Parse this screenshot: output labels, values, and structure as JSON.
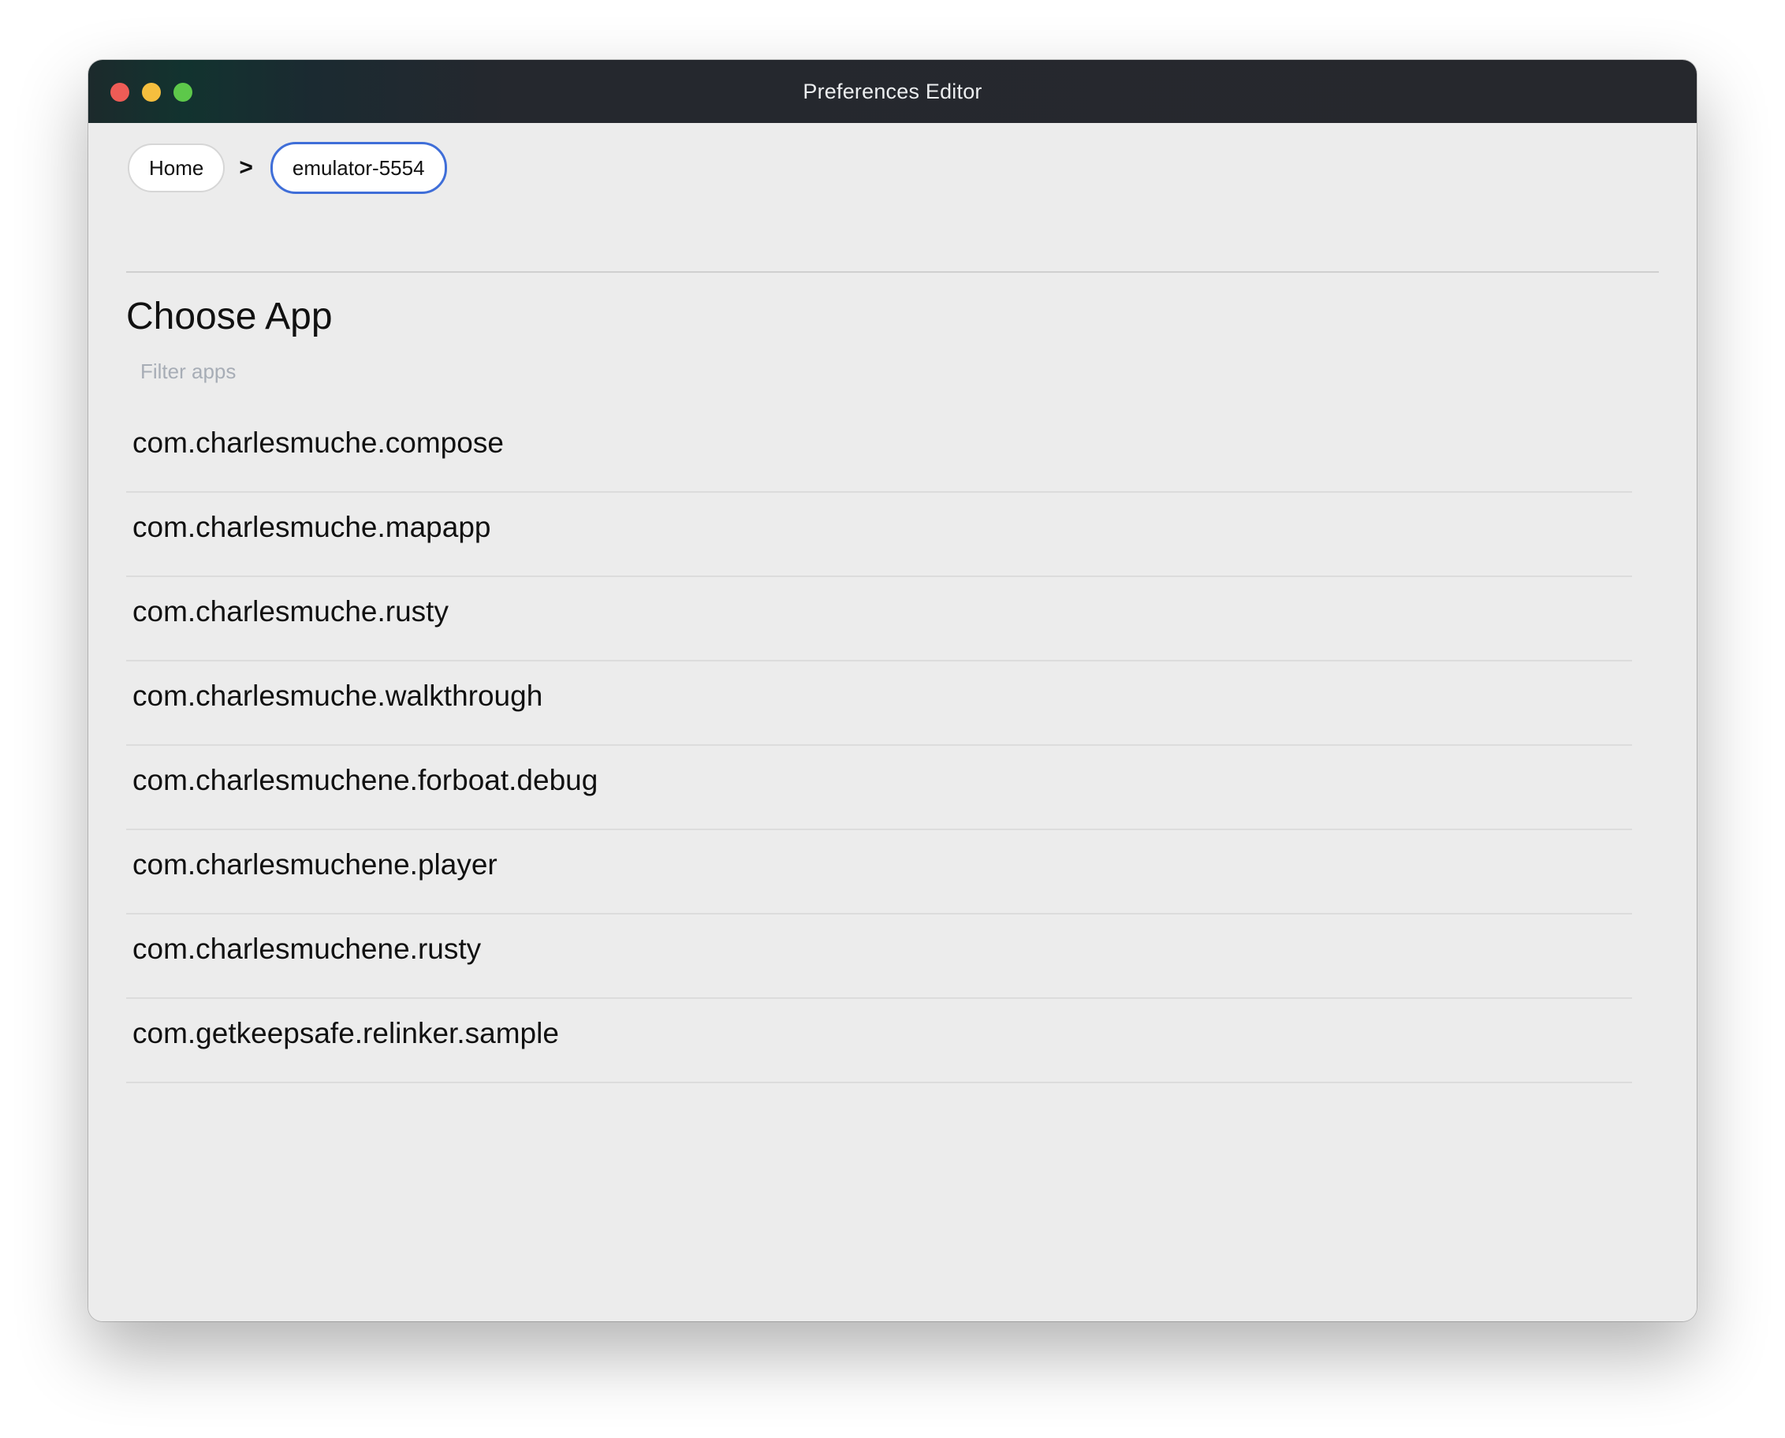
{
  "window": {
    "title": "Preferences Editor"
  },
  "breadcrumb": {
    "items": [
      {
        "label": "Home"
      },
      {
        "label": "emulator-5554"
      }
    ],
    "separator": ">"
  },
  "main": {
    "title": "Choose App",
    "filter": {
      "placeholder": "Filter apps",
      "value": ""
    },
    "apps": [
      "com.charlesmuche.compose",
      "com.charlesmuche.mapapp",
      "com.charlesmuche.rusty",
      "com.charlesmuche.walkthrough",
      "com.charlesmuchene.forboat.debug",
      "com.charlesmuchene.player",
      "com.charlesmuchene.rusty",
      "com.getkeepsafe.relinker.sample"
    ]
  },
  "colors": {
    "titlebar": "#26282d",
    "active_crumb_border": "#3f6ed8",
    "window_bg": "#ececec",
    "close": "#ee5c56",
    "minimize": "#f5be3e",
    "maximize": "#5dc84a"
  }
}
